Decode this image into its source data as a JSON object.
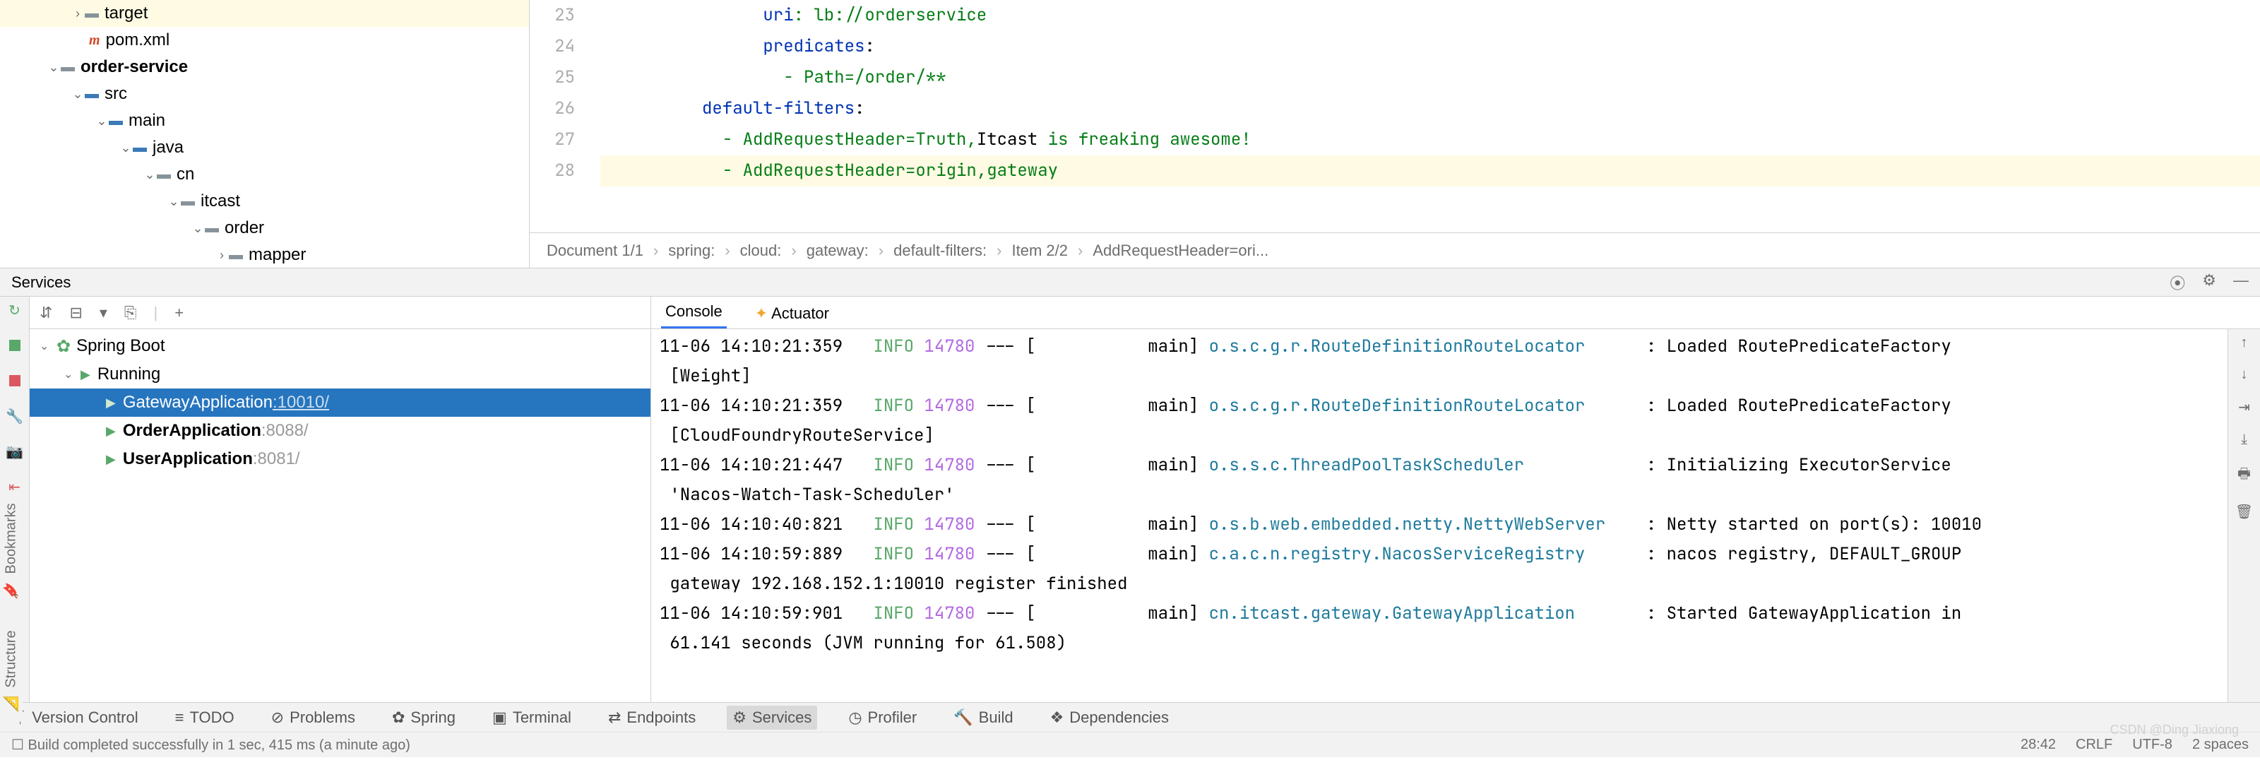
{
  "project_tree": [
    {
      "indent": 100,
      "arrow": "›",
      "icon": "folder",
      "label": "target",
      "hl": true
    },
    {
      "indent": 106,
      "arrow": "",
      "icon": "m",
      "label": "pom.xml",
      "hl": false
    },
    {
      "indent": 66,
      "arrow": "⌄",
      "icon": "folder",
      "label": "order-service",
      "hl": false,
      "bold": true
    },
    {
      "indent": 100,
      "arrow": "⌄",
      "icon": "src",
      "label": "src",
      "hl": false
    },
    {
      "indent": 134,
      "arrow": "⌄",
      "icon": "src",
      "label": "main",
      "hl": false
    },
    {
      "indent": 168,
      "arrow": "⌄",
      "icon": "src",
      "label": "java",
      "hl": false
    },
    {
      "indent": 202,
      "arrow": "⌄",
      "icon": "folder",
      "label": "cn",
      "hl": false
    },
    {
      "indent": 236,
      "arrow": "⌄",
      "icon": "folder",
      "label": "itcast",
      "hl": false
    },
    {
      "indent": 270,
      "arrow": "⌄",
      "icon": "folder",
      "label": "order",
      "hl": false
    },
    {
      "indent": 304,
      "arrow": "›",
      "icon": "folder",
      "label": "mapper",
      "hl": false
    }
  ],
  "editor": {
    "lines": [
      {
        "n": 23,
        "hl": false,
        "segments": [
          {
            "t": "                ",
            "c": "txt"
          },
          {
            "t": "uri",
            "c": "kw"
          },
          {
            "t": ": lb://orderservice",
            "c": "str"
          }
        ]
      },
      {
        "n": 24,
        "hl": false,
        "segments": [
          {
            "t": "                ",
            "c": "txt"
          },
          {
            "t": "predicates",
            "c": "kw"
          },
          {
            "t": ":",
            "c": "txt"
          }
        ]
      },
      {
        "n": 25,
        "hl": false,
        "segments": [
          {
            "t": "                  - Path=/order/**",
            "c": "str"
          }
        ]
      },
      {
        "n": 26,
        "hl": false,
        "segments": [
          {
            "t": "          ",
            "c": "txt"
          },
          {
            "t": "default-filters",
            "c": "kw"
          },
          {
            "t": ":",
            "c": "txt"
          }
        ]
      },
      {
        "n": 27,
        "hl": false,
        "segments": [
          {
            "t": "            - AddRequestHeader=Truth,",
            "c": "str"
          },
          {
            "t": "Itcast",
            "c": "txt"
          },
          {
            "t": " is freaking awesome!",
            "c": "str"
          }
        ]
      },
      {
        "n": 28,
        "hl": true,
        "segments": [
          {
            "t": "            - AddRequestHeader=origin,gateway",
            "c": "str"
          }
        ]
      }
    ],
    "breadcrumb": [
      "Document 1/1",
      "spring:",
      "cloud:",
      "gateway:",
      "default-filters:",
      "Item 2/2",
      "AddRequestHeader=ori..."
    ]
  },
  "services": {
    "title": "Services",
    "tree": {
      "root": "Spring Boot",
      "group": "Running",
      "apps": [
        {
          "name": "GatewayApplication",
          "port": ":10010/",
          "selected": true
        },
        {
          "name": "OrderApplication",
          "port": ":8088/",
          "selected": false
        },
        {
          "name": "UserApplication",
          "port": ":8081/",
          "selected": false
        }
      ]
    },
    "tabs": {
      "console": "Console",
      "actuator": "Actuator"
    }
  },
  "console_lines": [
    {
      "ts": "11-06 14:10:21:359",
      "lvl": "INFO",
      "pid": "14780",
      "thr": "main",
      "cls": "o.s.c.g.r.RouteDefinitionRouteLocator",
      "msg": ": Loaded RoutePredicateFactory"
    },
    {
      "cont": " [Weight]"
    },
    {
      "ts": "11-06 14:10:21:359",
      "lvl": "INFO",
      "pid": "14780",
      "thr": "main",
      "cls": "o.s.c.g.r.RouteDefinitionRouteLocator",
      "msg": ": Loaded RoutePredicateFactory"
    },
    {
      "cont": " [CloudFoundryRouteService]"
    },
    {
      "ts": "11-06 14:10:21:447",
      "lvl": "INFO",
      "pid": "14780",
      "thr": "main",
      "cls": "o.s.s.c.ThreadPoolTaskScheduler",
      "msg": ": Initializing ExecutorService"
    },
    {
      "cont": " 'Nacos-Watch-Task-Scheduler'"
    },
    {
      "ts": "11-06 14:10:40:821",
      "lvl": "INFO",
      "pid": "14780",
      "thr": "main",
      "cls": "o.s.b.web.embedded.netty.NettyWebServer",
      "msg": ": Netty started on port(s): 10010"
    },
    {
      "ts": "11-06 14:10:59:889",
      "lvl": "INFO",
      "pid": "14780",
      "thr": "main",
      "cls": "c.a.c.n.registry.NacosServiceRegistry",
      "msg": ": nacos registry, DEFAULT_GROUP"
    },
    {
      "cont": " gateway 192.168.152.1:10010 register finished"
    },
    {
      "ts": "11-06 14:10:59:901",
      "lvl": "INFO",
      "pid": "14780",
      "thr": "main",
      "cls": "cn.itcast.gateway.GatewayApplication",
      "msg": ": Started GatewayApplication in"
    },
    {
      "cont": " 61.141 seconds (JVM running for 61.508)"
    }
  ],
  "tool_tabs": [
    "Version Control",
    "TODO",
    "Problems",
    "Spring",
    "Terminal",
    "Endpoints",
    "Services",
    "Profiler",
    "Build",
    "Dependencies"
  ],
  "tool_tabs_active": "Services",
  "vertical_labels": {
    "bookmarks": "Bookmarks",
    "structure": "Structure"
  },
  "status": {
    "left": "Build completed successfully in 1 sec, 415 ms (a minute ago)",
    "right": [
      "28:42",
      "CRLF",
      "UTF-8",
      "2 spaces"
    ]
  },
  "watermark": "CSDN @Ding Jiaxiong"
}
